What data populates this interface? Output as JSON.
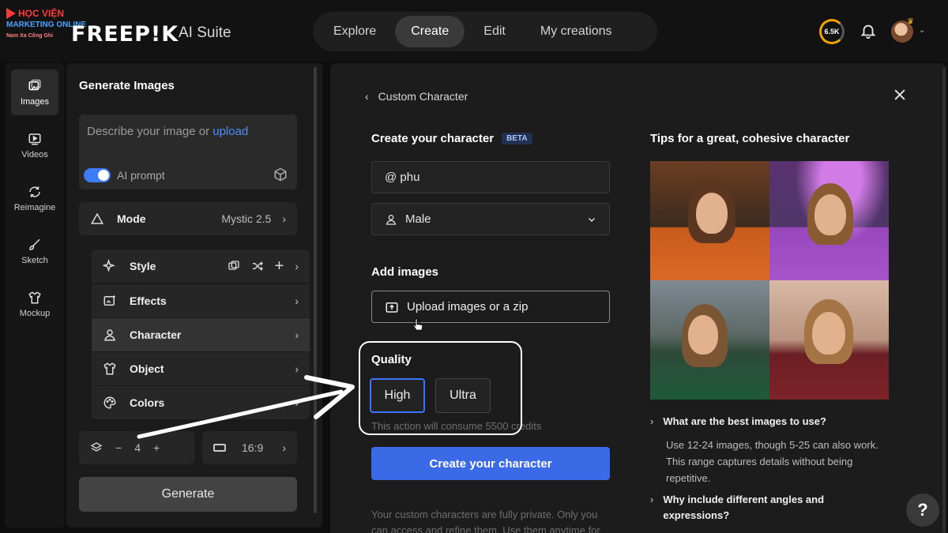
{
  "watermark": {
    "line1": "HỌC VIỆN",
    "line2": "MARKETING ONLINE",
    "line3": "Nam Xa Công Ghi"
  },
  "brand": {
    "name": "FREEP!K",
    "suite": "AI Suite"
  },
  "nav": {
    "tabs": [
      "Explore",
      "Create",
      "Edit",
      "My creations"
    ],
    "active": "Create"
  },
  "header": {
    "credits": "6.5K"
  },
  "rail": {
    "items": [
      {
        "label": "Images",
        "icon": "image-icon",
        "active": true
      },
      {
        "label": "Videos",
        "icon": "video-icon"
      },
      {
        "label": "Reimagine",
        "icon": "refresh-icon"
      },
      {
        "label": "Sketch",
        "icon": "brush-icon"
      },
      {
        "label": "Mockup",
        "icon": "shirt-icon"
      }
    ]
  },
  "generate": {
    "title": "Generate Images",
    "prompt_placeholder": "Describe your image or",
    "prompt_link": "upload",
    "ai_prompt_label": "AI prompt",
    "ai_prompt_on": true,
    "mode": {
      "label": "Mode",
      "value": "Mystic 2.5"
    },
    "options": [
      {
        "label": "Style",
        "icon": "sparkle-icon"
      },
      {
        "label": "Effects",
        "icon": "photo-effects-icon"
      },
      {
        "label": "Character",
        "icon": "person-icon",
        "highlighted": true
      },
      {
        "label": "Object",
        "icon": "object-icon"
      },
      {
        "label": "Colors",
        "icon": "palette-icon"
      }
    ],
    "count": "4",
    "count_minus": "−",
    "count_plus": "+",
    "ratio": "16:9",
    "generate_label": "Generate"
  },
  "character": {
    "back_label": "Custom Character",
    "section_title": "Create your character",
    "beta": "BETA",
    "name_value": "@ phu",
    "gender_value": "Male",
    "add_images_title": "Add images",
    "upload_label": "Upload images or a zip",
    "quality_title": "Quality",
    "quality_options": [
      "High",
      "Ultra"
    ],
    "quality_selected": "High",
    "consume_text": "This action will consume 5500 credits",
    "create_label": "Create your character",
    "private_text": "Your custom characters are fully private. Only you can access and refine them. Use them anytime for"
  },
  "tips": {
    "title": "Tips for a great, cohesive character",
    "q1": "What are the best images to use?",
    "a1": "Use 12-24 images, though 5-25 can also work. This range captures details without being repetitive.",
    "q2": "Why include different angles and expressions?"
  },
  "help_label": "?",
  "colors": {
    "accent": "#3a6ae6",
    "selected_border": "#3b74ff",
    "credits_ring": "#f0a500"
  }
}
